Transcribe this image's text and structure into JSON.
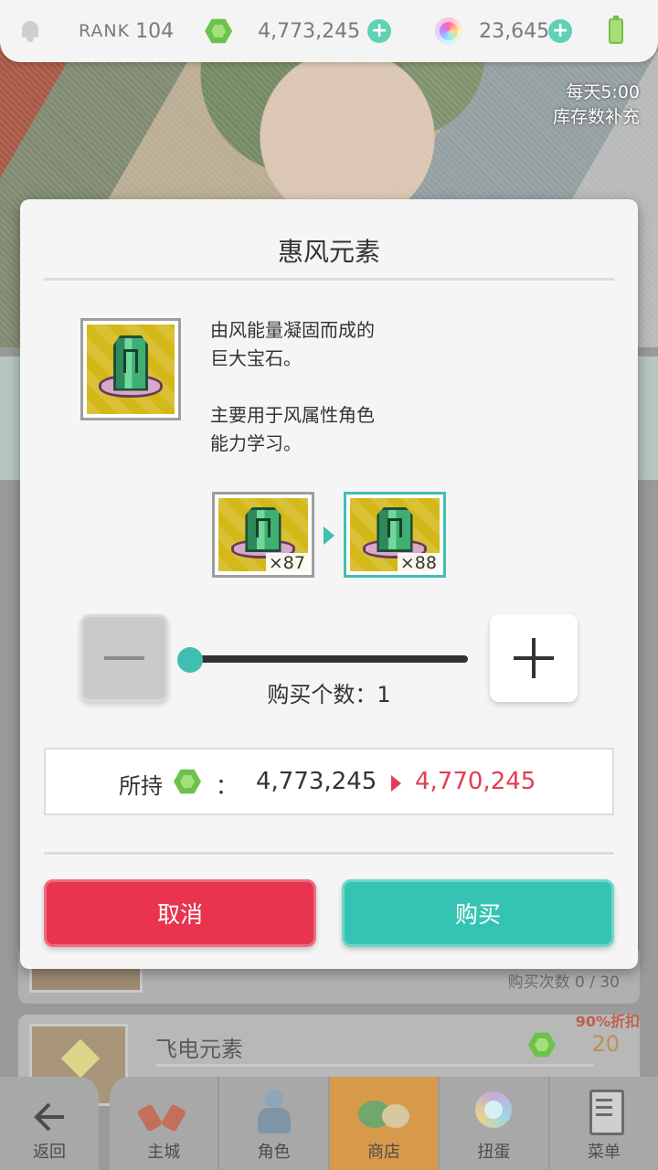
{
  "topbar": {
    "rank_label": "RANK",
    "rank_value": "104",
    "gems": "4,773,245",
    "orbs": "23,645",
    "plus": "+"
  },
  "banner": {
    "refill_time": "每天5:00",
    "refill_note": "库存数补充"
  },
  "modal": {
    "title": "惠风元素",
    "description": [
      "由风能量凝固而成的",
      "巨大宝石。",
      "",
      "主要用于风属性角色",
      "能力学习。"
    ],
    "owned_before": "×87",
    "owned_after": "×88",
    "quantity_label": "购买个数：1",
    "quantity": 1,
    "balance_label": "所持",
    "balance_colon": "：",
    "balance_current": "4,773,245",
    "balance_after": "4,770,245",
    "cancel_label": "取消",
    "buy_label": "购买"
  },
  "shop_list": {
    "prev_item_count": "购买次数 0 / 30",
    "item_name": "飞电元素",
    "item_price": "20",
    "item_badge": "90%折扣"
  },
  "nav": {
    "back": "返回",
    "items": [
      {
        "label": "主城",
        "icon": "castle-icon"
      },
      {
        "label": "角色",
        "icon": "character-icon"
      },
      {
        "label": "商店",
        "icon": "shop-icon",
        "active": true
      },
      {
        "label": "扭蛋",
        "icon": "gacha-icon"
      },
      {
        "label": "菜单",
        "icon": "menu-icon"
      }
    ]
  },
  "colors": {
    "accent": "#35c3b4",
    "cancel": "#e8344f",
    "price_after": "#e33c54"
  }
}
